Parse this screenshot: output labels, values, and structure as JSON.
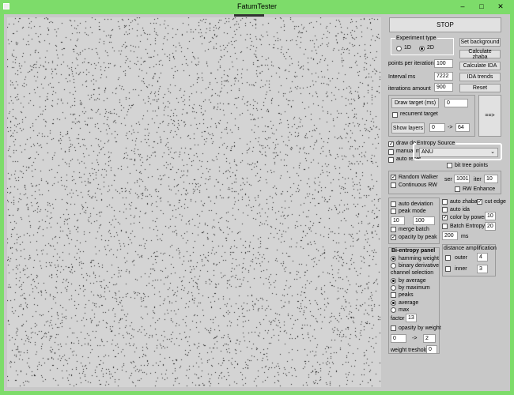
{
  "window": {
    "title": "FatumTester",
    "minimize": "–",
    "maximize": "□",
    "close": "✕"
  },
  "controls": {
    "stop": "STOP",
    "experiment_type": {
      "title": "Experiment type",
      "opt1": "1D",
      "opt2": "2D",
      "selected": "2D"
    },
    "buttons": {
      "set_background": "Set background",
      "calculate_zhaba": "Calculate zhaba",
      "calculate_ida": "Calculate IDA",
      "ida_trends": "IDA trends",
      "reset": "Reset"
    },
    "points_per_iteration": {
      "label": "points per iteration",
      "value": "100"
    },
    "interval": {
      "label": "Interval ms",
      "value": "7222"
    },
    "iterations": {
      "label": "iterations amount",
      "value": "900"
    },
    "draw_target": {
      "label": "Draw target (ms)",
      "value": "0"
    },
    "recurrent_target": "recurrent target",
    "arrow_button": "==>",
    "show_layers": {
      "label": "Show layers",
      "from": "0",
      "arrow": "->",
      "to": "64"
    },
    "draw_dots": "draw dots",
    "manual_mode": "manual mode",
    "auto_reset": "auto reset",
    "entropy_source": {
      "title": "Entropy Source",
      "value": "ANU"
    },
    "bit_tree_points": "bit tree points",
    "random_walker": "Random Walker",
    "continuous_rw": "Continuous  RW",
    "ser": {
      "label": "ser",
      "value": "1001"
    },
    "iter": {
      "label": "iter",
      "value": "10"
    },
    "rw_enhance": "RW Enhance",
    "auto_deviation": "auto deviation",
    "peak_mode": "peak mode",
    "peak_from": "10",
    "peak_to": "100",
    "merge_batch": "merge batch",
    "opacity_by_peak": "opacity by peak",
    "auto_zhaba": "auto zhaba",
    "cut_edge": "cut edge",
    "auto_ida": "auto ida",
    "color_by_power": {
      "label": "color by power",
      "value": "10"
    },
    "batch_entropy": {
      "label": "Batch Entropy",
      "value": "20"
    },
    "batch_ms": {
      "value": "200",
      "unit": "ms"
    },
    "bi_entropy": {
      "title": "Bi-entropy panel",
      "hamming_weight": "hamming weight",
      "binary_derivative": "binary derivative",
      "channel_selection": "channel selection",
      "by_average": "by average",
      "by_maximum": "by maximum",
      "peaks": "peaks",
      "average": "average",
      "max": "max",
      "factor": {
        "label": "factor",
        "value": "13"
      },
      "opacity_by_weight": "opasity by weight",
      "range_from": "0",
      "range_arrow": "->",
      "range_to": "2",
      "weight_threshold": {
        "label": "weight treshold",
        "value": "0"
      }
    },
    "distance_amplification": {
      "title": "distance amplification",
      "outer": {
        "label": "outer",
        "value": "4"
      },
      "inner": {
        "label": "inner",
        "value": "3"
      }
    }
  }
}
